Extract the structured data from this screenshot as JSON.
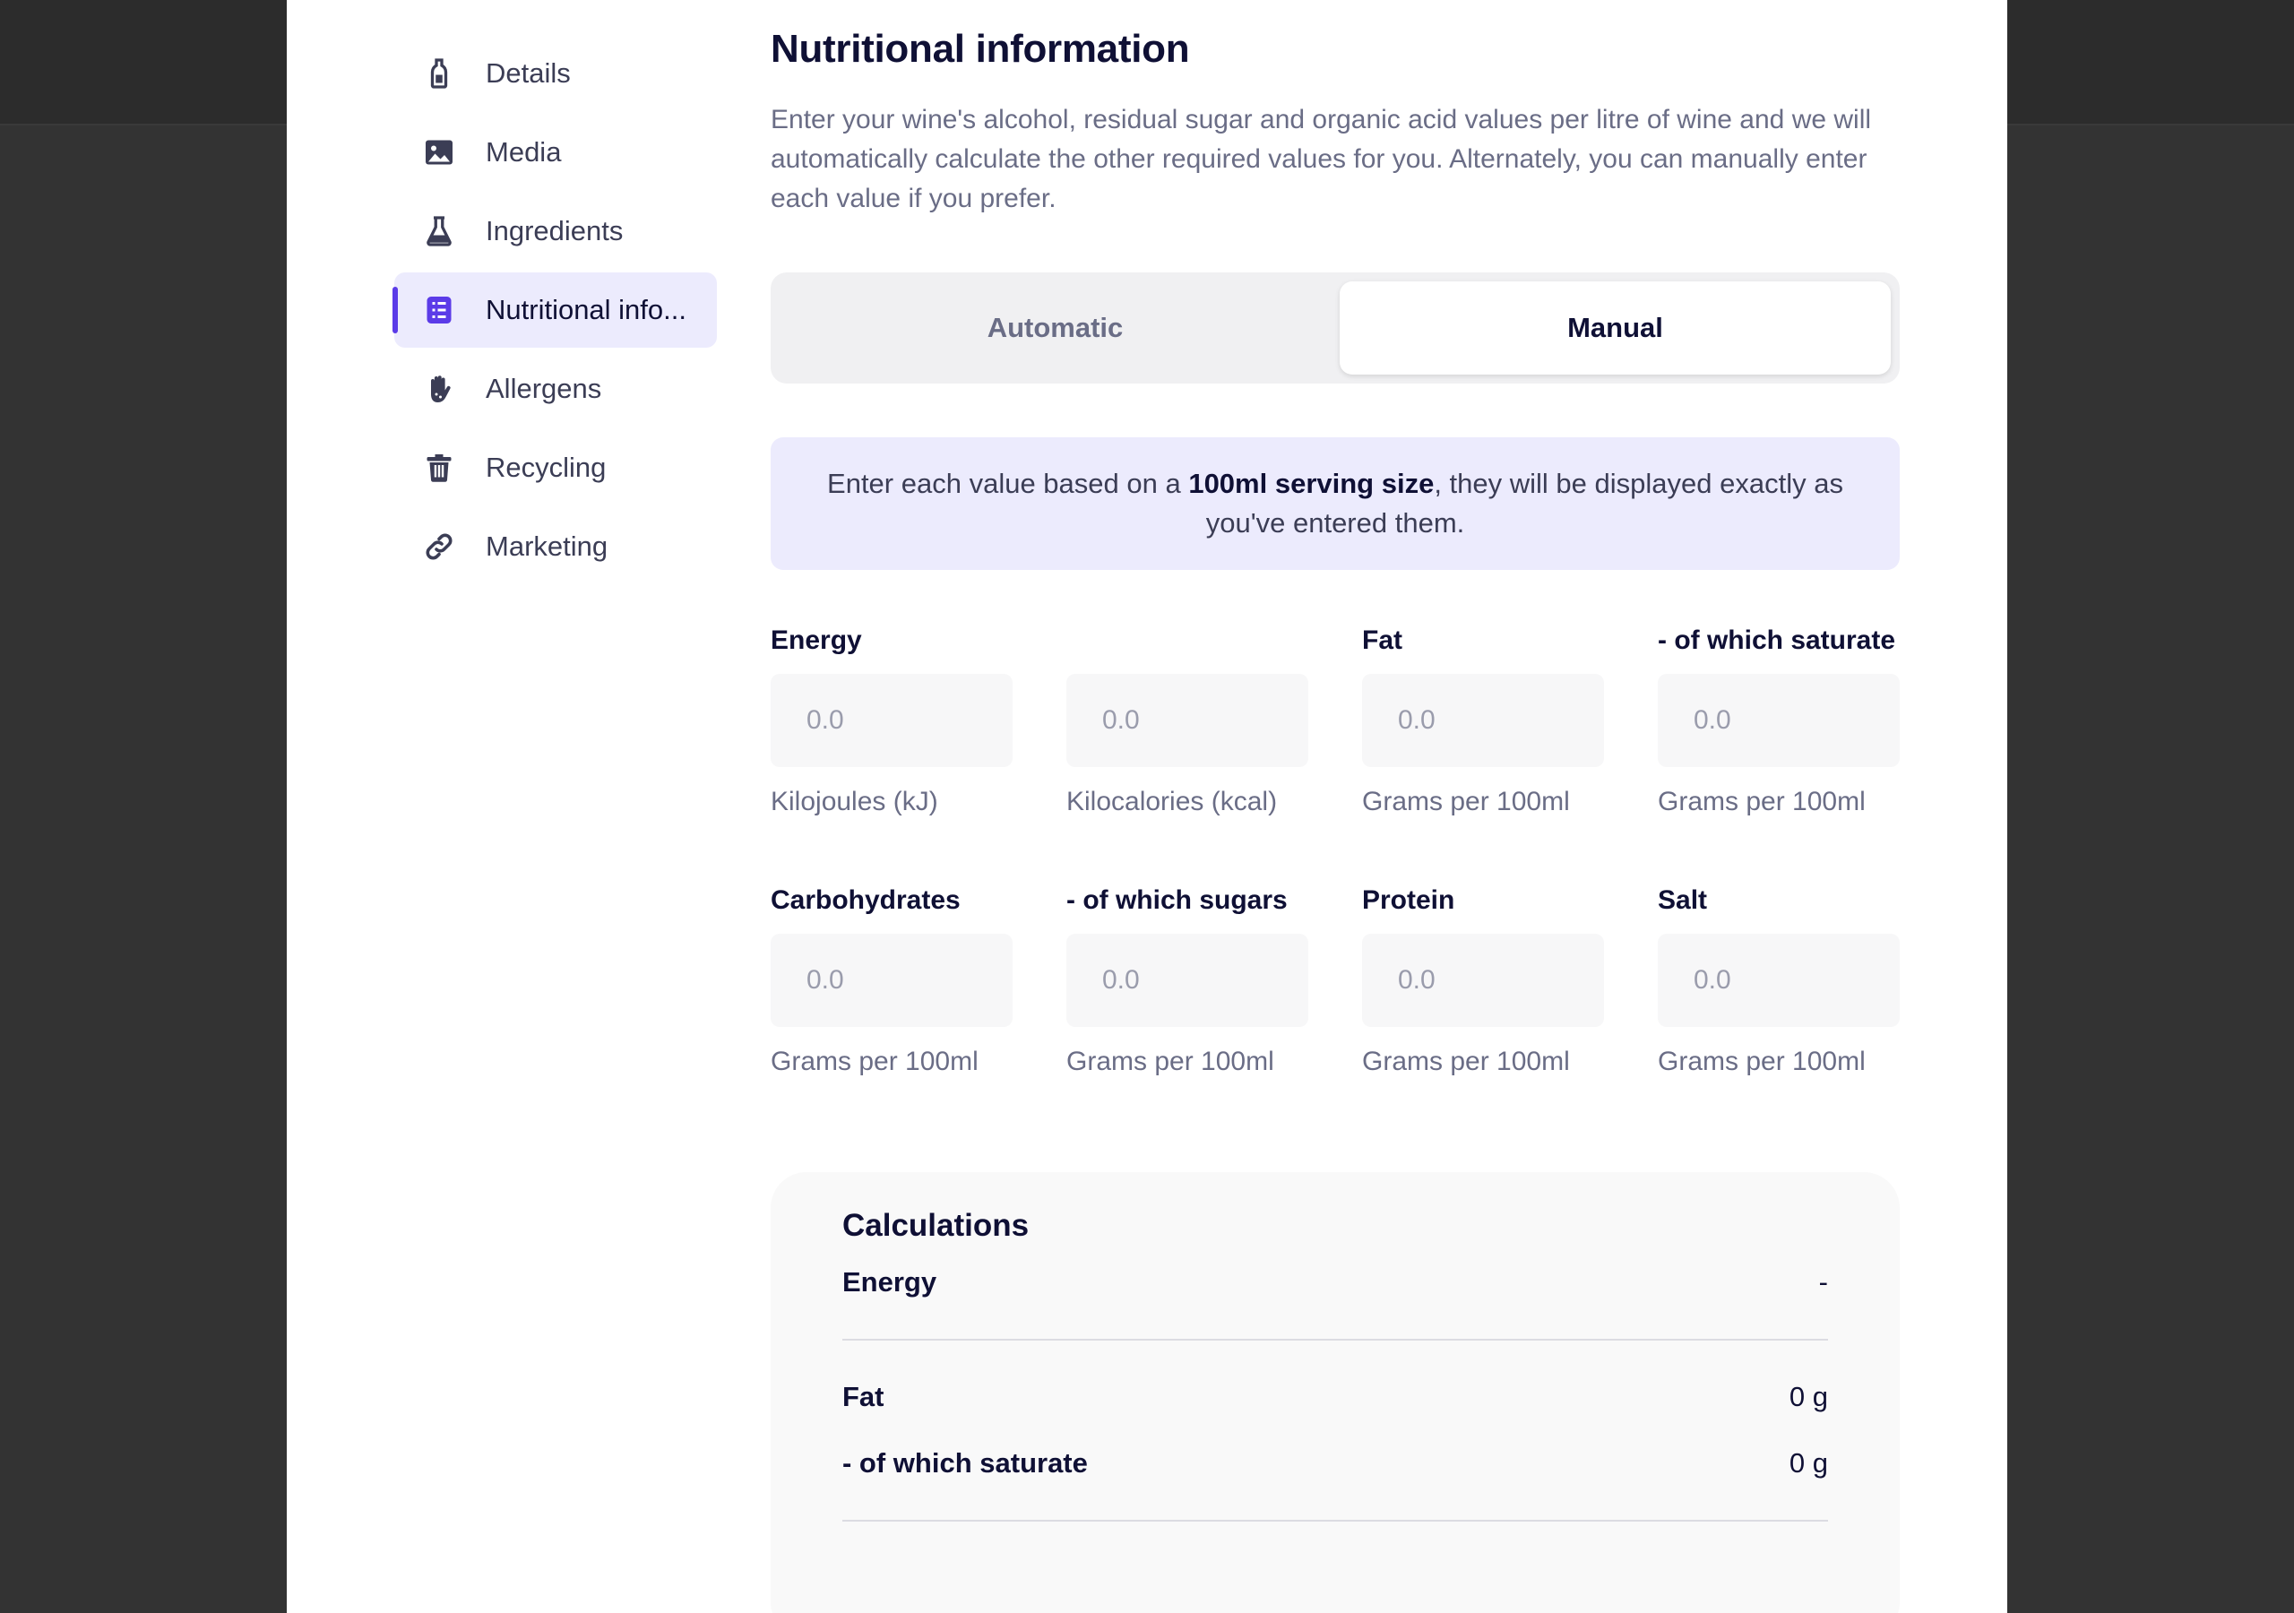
{
  "sidebar": {
    "items": [
      {
        "label": "Details",
        "icon": "bottle-icon",
        "active": false
      },
      {
        "label": "Media",
        "icon": "image-icon",
        "active": false
      },
      {
        "label": "Ingredients",
        "icon": "flask-icon",
        "active": false
      },
      {
        "label": "Nutritional info...",
        "icon": "document-list-icon",
        "active": true
      },
      {
        "label": "Allergens",
        "icon": "hand-icon",
        "active": false
      },
      {
        "label": "Recycling",
        "icon": "trash-icon",
        "active": false
      },
      {
        "label": "Marketing",
        "icon": "link-icon",
        "active": false
      }
    ]
  },
  "main": {
    "title": "Nutritional information",
    "intro": "Enter your wine's alcohol, residual sugar and organic acid values per litre of wine and we will automatically calculate the other required values for you. Alternately, you can manually enter each value if you prefer.",
    "toggle": {
      "automatic": "Automatic",
      "manual": "Manual",
      "selected": "manual"
    },
    "notice": {
      "before": "Enter each value based on a ",
      "bold": "100ml serving size",
      "after": ", they will be displayed exactly as you've entered them."
    },
    "fields": [
      {
        "label": "Energy",
        "placeholder": "0.0",
        "help": "Kilojoules (kJ)"
      },
      {
        "label": "",
        "placeholder": "0.0",
        "help": "Kilocalories (kcal)"
      },
      {
        "label": "Fat",
        "placeholder": "0.0",
        "help": "Grams per 100ml"
      },
      {
        "label": "- of which saturate",
        "placeholder": "0.0",
        "help": "Grams per 100ml"
      },
      {
        "label": "Carbohydrates",
        "placeholder": "0.0",
        "help": "Grams per 100ml"
      },
      {
        "label": "- of which sugars",
        "placeholder": "0.0",
        "help": "Grams per 100ml"
      },
      {
        "label": "Protein",
        "placeholder": "0.0",
        "help": "Grams per 100ml"
      },
      {
        "label": "Salt",
        "placeholder": "0.0",
        "help": "Grams per 100ml"
      }
    ],
    "calculations": {
      "title": "Calculations",
      "energy": {
        "label": "Energy",
        "value": "-"
      },
      "fat": {
        "label": "Fat",
        "value": "0 g"
      },
      "saturate": {
        "label": "- of which saturate",
        "value": "0 g"
      }
    }
  },
  "colors": {
    "accent": "#5b3be8",
    "active_bg": "#ecebfd",
    "backdrop": "#333333"
  }
}
